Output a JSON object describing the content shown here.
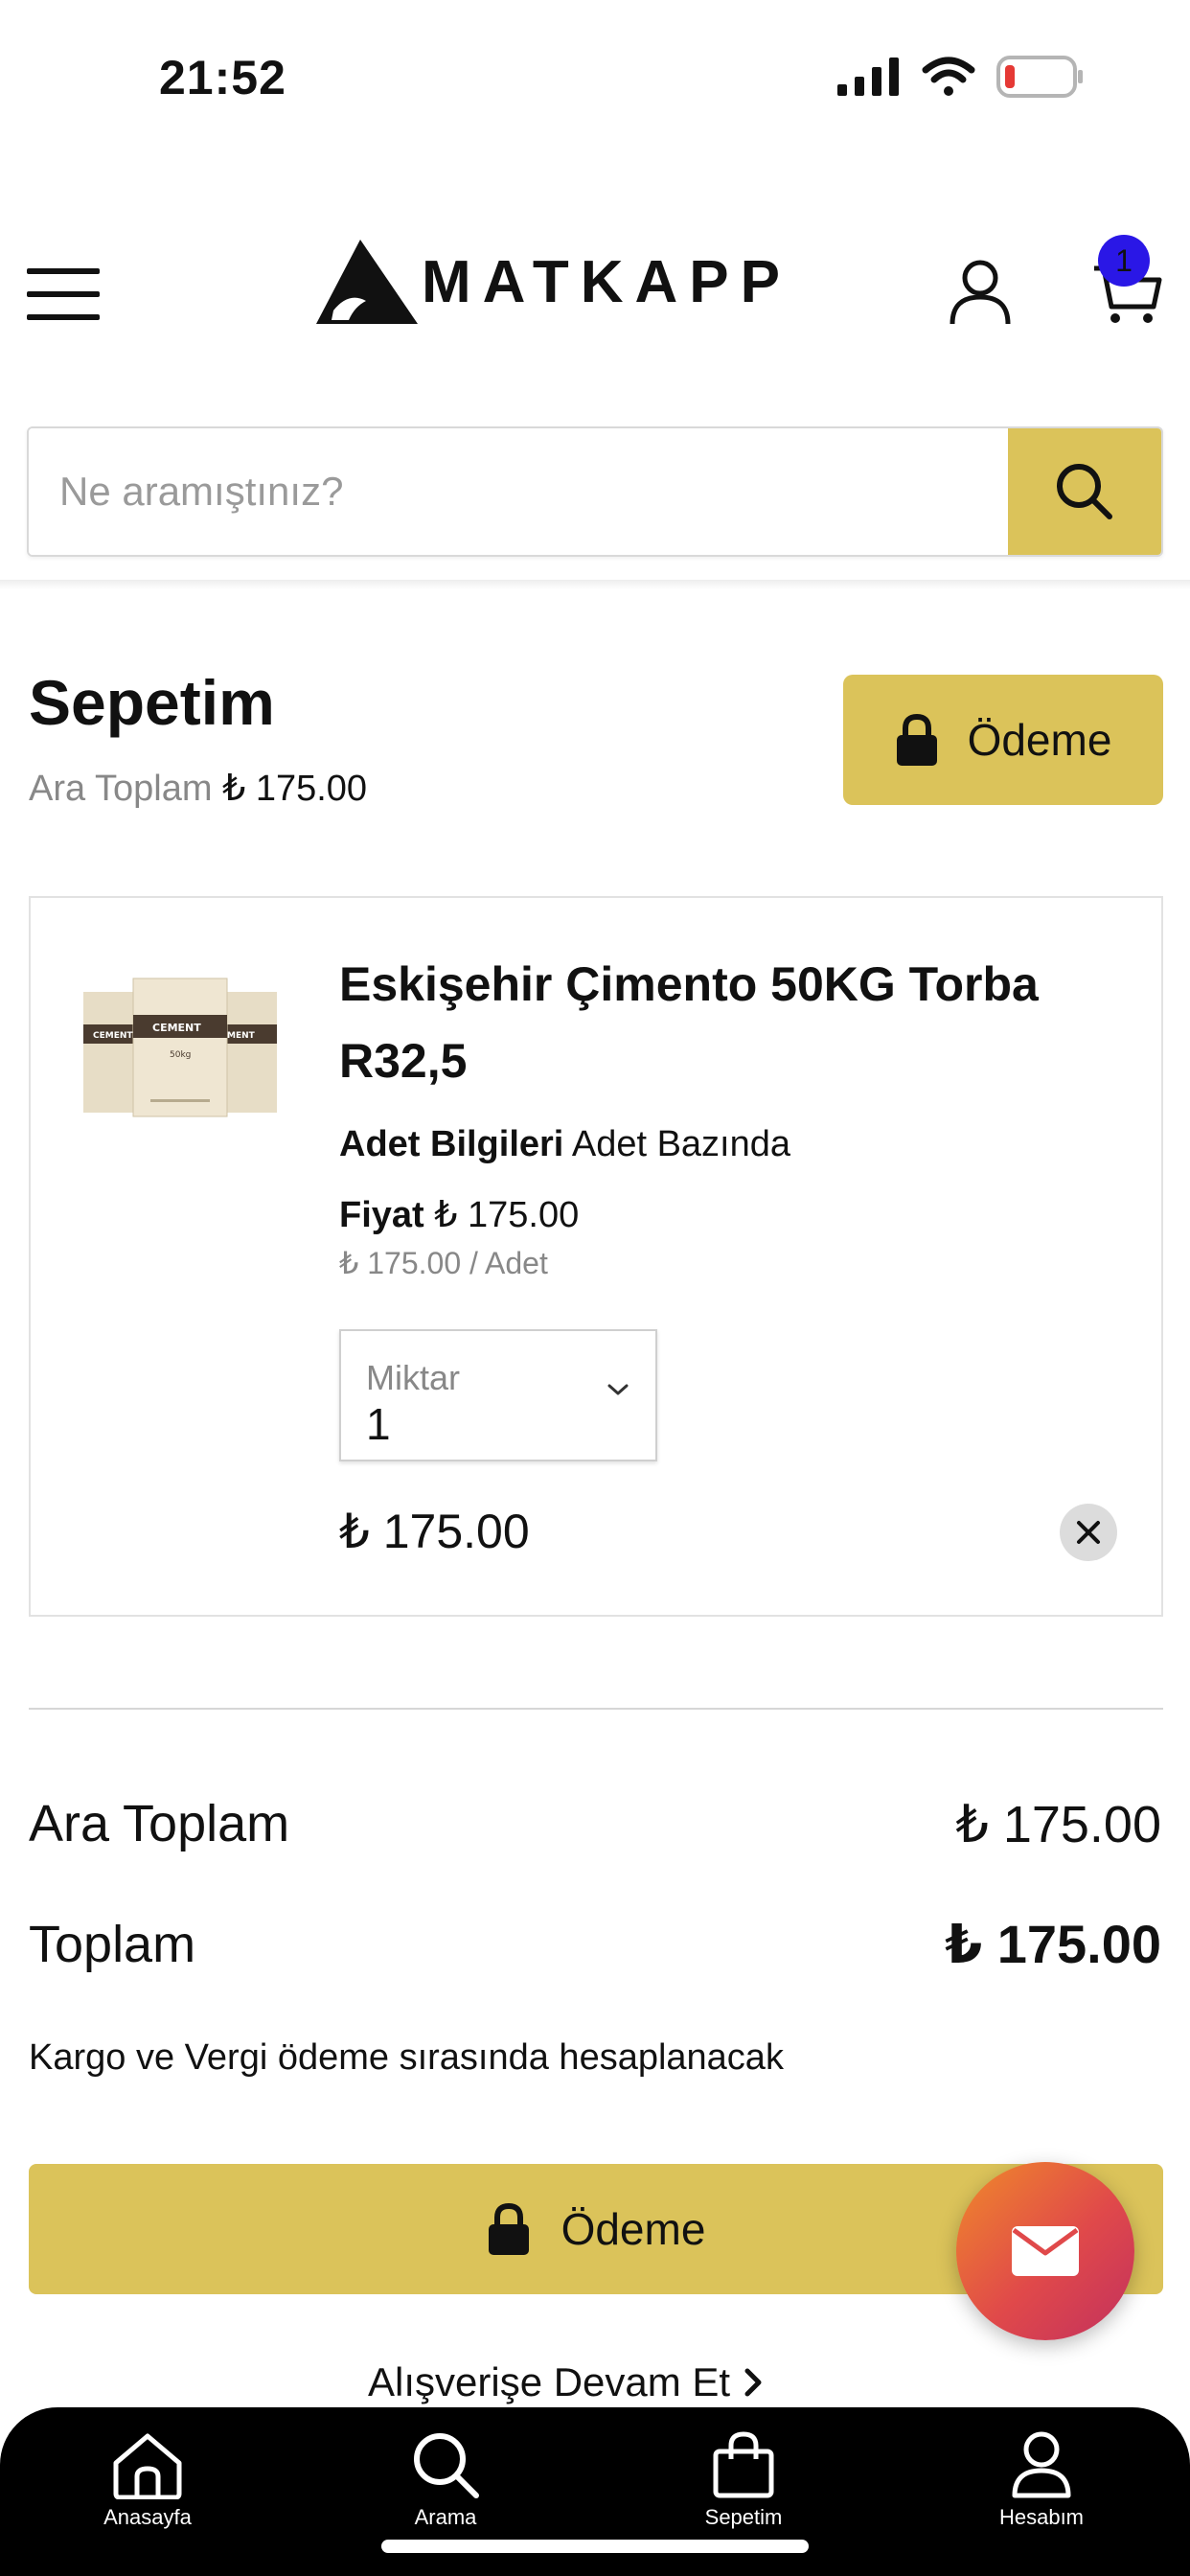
{
  "status_bar": {
    "time": "21:52"
  },
  "header": {
    "logo_text": "MATKAPP",
    "cart_count": "1"
  },
  "search": {
    "placeholder": "Ne aramıştınız?"
  },
  "cart": {
    "title": "Sepetim",
    "subtotal_label": "Ara Toplam",
    "subtotal_value": "₺ 175.00",
    "checkout_label": "Ödeme"
  },
  "item": {
    "name": "Eskişehir Çimento 50KG Torba R32,5",
    "units_label": "Adet Bilgileri",
    "units_value": "Adet Bazında",
    "price_label": "Fiyat",
    "price_value": "₺ 175.00",
    "unit_price": "₺ 175.00 / Adet",
    "qty_label": "Miktar",
    "qty_value": "1",
    "line_total": "₺ 175.00",
    "thumb_bag_labels": [
      "CEMENT",
      "CEMENT",
      "MENT"
    ],
    "thumb_weight": "50kg"
  },
  "summary": {
    "subtotal_label": "Ara Toplam",
    "subtotal_value": "₺ 175.00",
    "total_label": "Toplam",
    "total_value": "₺ 175.00",
    "shipping_note": "Kargo ve Vergi ödeme sırasında hesaplanacak",
    "checkout_label": "Ödeme",
    "continue_label": "Alışverişe Devam Et"
  },
  "bottom_nav": {
    "items": [
      {
        "label": "Anasayfa",
        "icon": "home-icon"
      },
      {
        "label": "Arama",
        "icon": "search-icon"
      },
      {
        "label": "Sepetim",
        "icon": "bag-icon"
      },
      {
        "label": "Hesabım",
        "icon": "user-icon"
      }
    ]
  },
  "colors": {
    "accent": "#dbc35a",
    "badge": "#2a17e6",
    "nav_bg": "#000000",
    "fab_gradient_start": "#f08a2a",
    "fab_gradient_end": "#c2305e"
  }
}
